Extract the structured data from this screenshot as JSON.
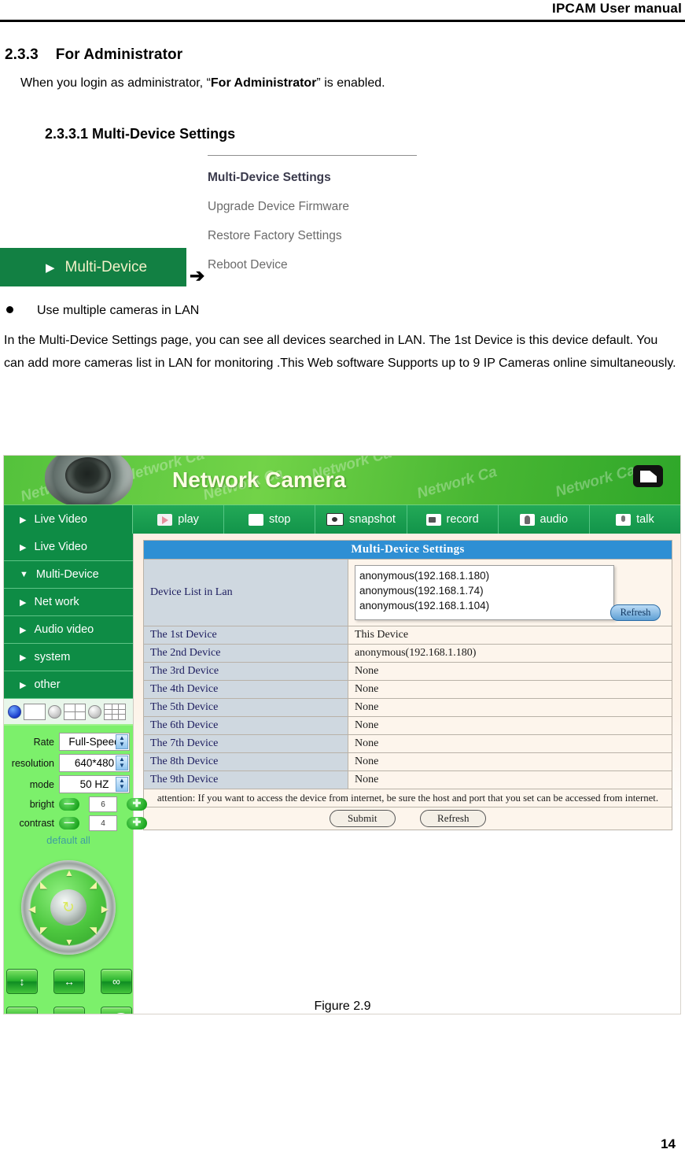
{
  "header": {
    "title": "IPCAM User manual"
  },
  "document": {
    "section_number": "2.3.3",
    "section_title": "For Administrator",
    "intro_before": "When you login as administrator, “",
    "intro_bold": "For Administrator",
    "intro_after": "” is enabled.",
    "subsection_title": "2.3.3.1 Multi-Device Settings",
    "bullet_text": "Use multiple cameras in LAN",
    "paragraph": "In the Multi-Device Settings page, you can see all devices searched in LAN. The 1st Device is this device default. You can add more cameras list in LAN for monitoring .This Web software Supports up to 9 IP Cameras online simultaneously.",
    "figure_caption": "Figure 2.9",
    "page_number": "14"
  },
  "menu_fragment": {
    "tab_label": "Multi-Device",
    "arrow": "➔",
    "items": [
      {
        "label": "Multi-Device Settings",
        "active": true
      },
      {
        "label": "Upgrade Device Firmware",
        "active": false
      },
      {
        "label": "Restore Factory Settings",
        "active": false
      },
      {
        "label": "Reboot Device",
        "active": false
      }
    ]
  },
  "screenshot": {
    "banner": {
      "title": "Network Camera",
      "watermarks": [
        "Network Ca",
        "Network Ca",
        "Network Ca",
        "Network Ca",
        "Network Ca",
        "Network Ca"
      ]
    },
    "toolbar": {
      "live_video_label": "Live Video",
      "buttons": [
        {
          "label": "play",
          "icon": "play-icon"
        },
        {
          "label": "stop",
          "icon": "stop-icon"
        },
        {
          "label": "snapshot",
          "icon": "snapshot-icon"
        },
        {
          "label": "record",
          "icon": "record-icon"
        },
        {
          "label": "audio",
          "icon": "audio-icon"
        },
        {
          "label": "talk",
          "icon": "talk-icon"
        }
      ]
    },
    "sidebar": {
      "nav": [
        {
          "label": "Live Video",
          "expanded": false
        },
        {
          "label": "Multi-Device",
          "expanded": true
        },
        {
          "label": "Net work",
          "expanded": false
        },
        {
          "label": "Audio video",
          "expanded": false
        },
        {
          "label": "system",
          "expanded": false
        },
        {
          "label": "other",
          "expanded": false
        }
      ],
      "settings": {
        "rate_label": "Rate",
        "rate_value": "Full-Speed",
        "resolution_label": "resolution",
        "resolution_value": "640*480",
        "mode_label": "mode",
        "mode_value": "50 HZ",
        "bright_label": "bright",
        "bright_value": "6",
        "contrast_label": "contrast",
        "contrast_value": "4",
        "default_all_label": "default all",
        "minus": "—",
        "plus": "✚"
      }
    },
    "panel": {
      "title": "Multi-Device Settings",
      "device_list_label": "Device List in Lan",
      "device_list_items": [
        "anonymous(192.168.1.180)",
        "anonymous(192.168.1.74)",
        "anonymous(192.168.1.104)"
      ],
      "refresh_label": "Refresh",
      "rows": [
        {
          "label": "The 1st Device",
          "value": "This Device"
        },
        {
          "label": "The 2nd Device",
          "value": "anonymous(192.168.1.180)"
        },
        {
          "label": "The 3rd Device",
          "value": "None"
        },
        {
          "label": "The 4th Device",
          "value": "None"
        },
        {
          "label": "The 5th Device",
          "value": "None"
        },
        {
          "label": "The 6th Device",
          "value": "None"
        },
        {
          "label": "The 7th Device",
          "value": "None"
        },
        {
          "label": "The 8th Device",
          "value": "None"
        },
        {
          "label": "The 9th Device",
          "value": "None"
        }
      ],
      "attention": "attention: If you want to access the device from internet, be sure the host and port that you set can be accessed from internet.",
      "submit_label": "Submit",
      "bottom_refresh_label": "Refresh"
    }
  },
  "colors": {
    "brand_green": "#0e8c45",
    "banner_green": "#54c23c",
    "panel_blue": "#2e8fd4",
    "sidebar_green": "#7cf06b",
    "label_cell": "#cfd8e0"
  }
}
